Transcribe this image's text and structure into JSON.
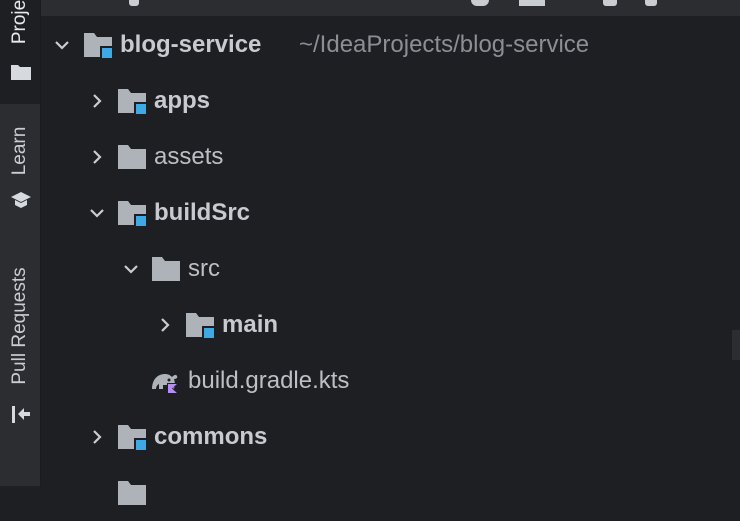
{
  "toolwindow_strip": {
    "tabs": [
      {
        "label": "Proje",
        "icon": "folder-icon",
        "active": true
      },
      {
        "label": "Learn",
        "icon": "graduation-cap-icon",
        "active": false
      },
      {
        "label": "Pull Requests",
        "icon": "pull-request-icon",
        "active": false
      }
    ]
  },
  "tree": {
    "root": {
      "name": "blog-service",
      "path": "~/IdeaProjects/blog-service",
      "icon": "module-folder-icon"
    },
    "nodes": [
      {
        "name": "apps",
        "icon": "module-folder-icon",
        "expanded": false,
        "bold": true
      },
      {
        "name": "assets",
        "icon": "folder-icon",
        "expanded": false,
        "bold": false
      },
      {
        "name": "buildSrc",
        "icon": "module-folder-icon",
        "expanded": true,
        "bold": true
      },
      {
        "name": "src",
        "icon": "folder-icon",
        "expanded": true,
        "bold": false
      },
      {
        "name": "main",
        "icon": "module-folder-icon",
        "expanded": false,
        "bold": true
      },
      {
        "name": "build.gradle.kts",
        "icon": "gradle-kotlin-icon",
        "bold": false
      },
      {
        "name": "commons",
        "icon": "module-folder-icon",
        "expanded": false,
        "bold": true
      }
    ]
  },
  "colors": {
    "background": "#1e1f22",
    "strip": "#2b2d30",
    "folder": "#aeb3ba",
    "module_badge": "#3fa9e6",
    "kotlin_badge": "#b58cf0",
    "text": "#bcbfc4"
  }
}
